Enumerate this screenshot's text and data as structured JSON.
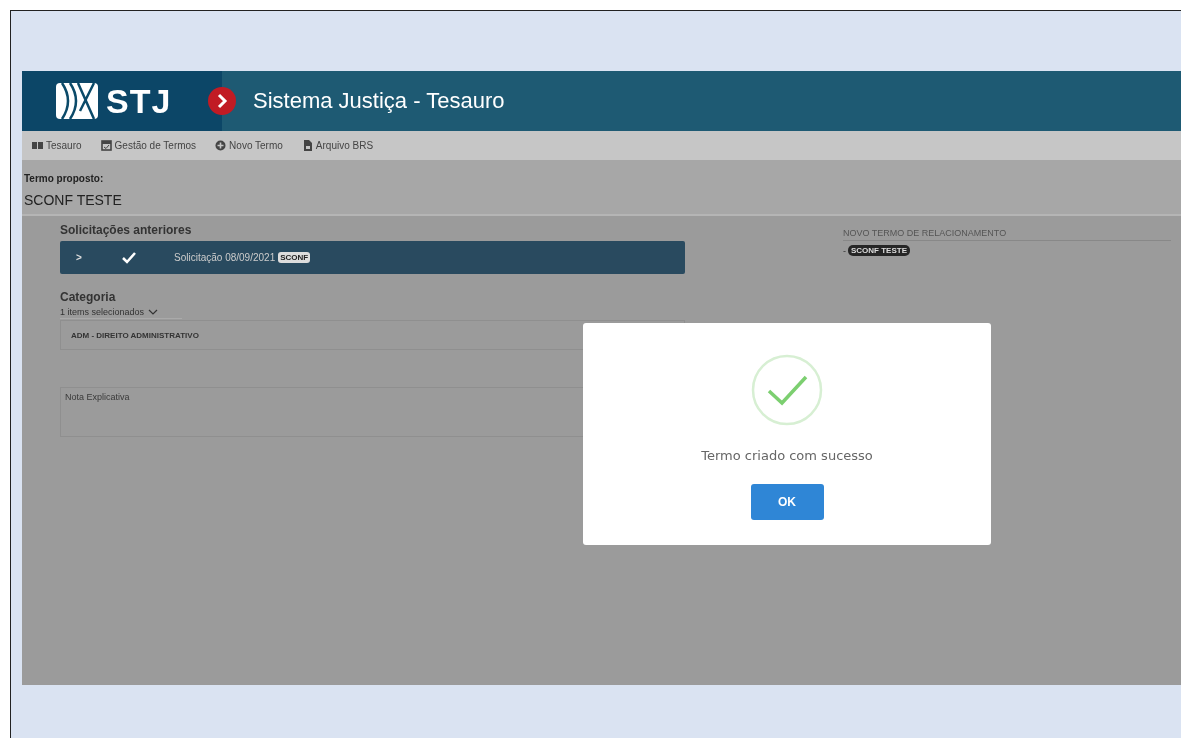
{
  "header": {
    "logo_text": "STJ",
    "title": "Sistema Justiça - Tesauro"
  },
  "nav": [
    {
      "kind": "book",
      "label": "Tesauro"
    },
    {
      "kind": "calendar",
      "label": "Gestão de Termos"
    },
    {
      "kind": "plus",
      "label": "Novo Termo"
    },
    {
      "kind": "file",
      "label": "Arquivo BRS"
    }
  ],
  "proposed_term": {
    "label": "Termo proposto:",
    "value": "SCONF TESTE"
  },
  "previous_requests": {
    "title": "Solicitações anteriores",
    "items": [
      {
        "expand": ">",
        "checked": true,
        "label": "Solicitação 08/09/2021",
        "tag": "SCONF"
      }
    ]
  },
  "category": {
    "title": "Categoria",
    "selector": "1 items selecionados",
    "selected_item": "ADM - DIREITO ADMINISTRATIVO"
  },
  "note": {
    "placeholder": "Nota Explicativa"
  },
  "relationship": {
    "title": "NOVO TERMO DE RELACIONAMENTO",
    "items": [
      {
        "bullet": "-",
        "term": "SCONF TESTE"
      }
    ]
  },
  "dialog": {
    "message": "Termo criado com sucesso",
    "button": "OK"
  }
}
